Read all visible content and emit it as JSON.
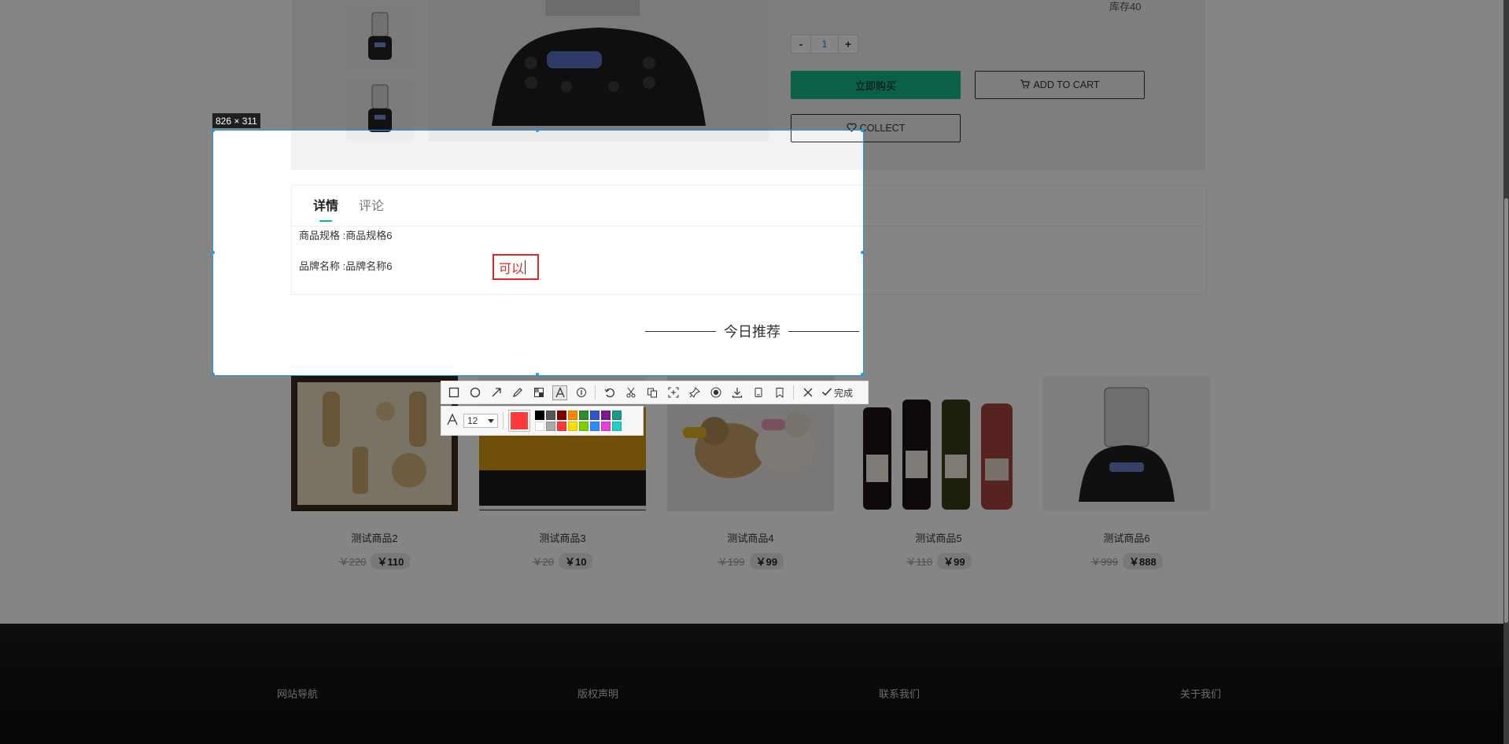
{
  "product": {
    "stock_label": "库存40",
    "qty": {
      "minus": "-",
      "value": "1",
      "plus": "+"
    },
    "buy_now": "立即购买",
    "add_to_cart": "ADD TO CART",
    "collect": "COLLECT"
  },
  "detail": {
    "tabs": [
      {
        "label": "详情"
      },
      {
        "label": "评论"
      }
    ],
    "specs": [
      {
        "text": "商品规格 :商品规格6"
      },
      {
        "text": "品牌名称 :品牌名称6"
      }
    ]
  },
  "recommend": {
    "title": "今日推荐",
    "products": [
      {
        "name": "测试商品2",
        "old_price": "￥220",
        "price": "￥110"
      },
      {
        "name": "测试商品3",
        "old_price": "￥20",
        "price": "￥10"
      },
      {
        "name": "测试商品4",
        "old_price": "￥199",
        "price": "￥99"
      },
      {
        "name": "测试商品5",
        "old_price": "￥110",
        "price": "￥99"
      },
      {
        "name": "测试商品6",
        "old_price": "￥999",
        "price": "￥888"
      }
    ]
  },
  "footer": {
    "links": [
      {
        "label": "网站导航"
      },
      {
        "label": "版权声明"
      },
      {
        "label": "联系我们"
      },
      {
        "label": "关于我们"
      }
    ]
  },
  "capture": {
    "size_label": "826 × 311",
    "annotation_text": "可以",
    "toolbar": {
      "tools": [
        "rectangle-tool",
        "ellipse-tool",
        "arrow-tool",
        "pencil-tool",
        "mosaic-tool",
        "text-tool",
        "serial-number-tool",
        "undo-tool",
        "cutout-tool",
        "ocr-tool",
        "scroll-capture-tool",
        "pin-tool",
        "record-tool",
        "save-tool",
        "copy-tool",
        "bookmark-tool"
      ],
      "done_label": "完成"
    },
    "text_options": {
      "font_size": "12",
      "current_color": "#ff3b3b",
      "palette": [
        "#000000",
        "#555555",
        "#7f0000",
        "#ff8a00",
        "#2e8b2e",
        "#3355cc",
        "#7a1a8a",
        "#1a9a8a",
        "#ffffff",
        "#aaaaaa",
        "#ff3b3b",
        "#ffe000",
        "#7cd000",
        "#2e8bff",
        "#e040e0",
        "#20d0c8"
      ]
    }
  }
}
